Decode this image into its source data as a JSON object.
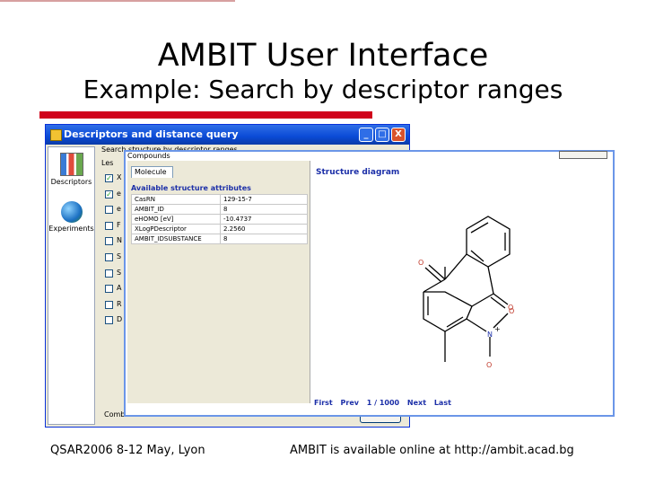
{
  "slide": {
    "title": "AMBIT  User Interface",
    "subtitle": "Example: Search by descriptor ranges",
    "footer_left": "QSAR2006 8-12 May, Lyon",
    "footer_right": "AMBIT is available online at http://ambit.acad.bg",
    "accent_color": "#d0021b"
  },
  "back_window": {
    "title": "Descriptors and distance query",
    "header_text": "Search structure by descriptor ranges",
    "column_label": "Les",
    "nav": [
      {
        "label": "Descriptors",
        "icon": "bar-chart-icon"
      },
      {
        "label": "Experiments",
        "icon": "globe-icon"
      }
    ],
    "rows": [
      {
        "checked": true,
        "label": "X"
      },
      {
        "checked": true,
        "label": "e"
      },
      {
        "checked": false,
        "label": "e"
      },
      {
        "checked": false,
        "label": "F"
      },
      {
        "checked": false,
        "label": "N"
      },
      {
        "checked": false,
        "label": "S"
      },
      {
        "checked": false,
        "label": "S"
      },
      {
        "checked": false,
        "label": "A"
      },
      {
        "checked": false,
        "label": "R"
      },
      {
        "checked": false,
        "label": "D"
      }
    ],
    "bottom_text": "Comb",
    "controls": {
      "minimize": "_",
      "maximize": "□",
      "close": "X"
    }
  },
  "front_window": {
    "tab_header": "Compounds",
    "molecule_tab": "Molecule",
    "attributes_title": "Available structure attributes",
    "attributes": [
      {
        "key": "CasRN",
        "value": "129-15-7"
      },
      {
        "key": "AMBIT_ID",
        "value": "8"
      },
      {
        "key": "eHOMO [eV]",
        "value": "-10.4737"
      },
      {
        "key": "XLogPDescriptor",
        "value": "2.2560"
      },
      {
        "key": "AMBIT_IDSUBSTANCE",
        "value": "8"
      }
    ],
    "structure_title": "Structure diagram",
    "atoms": {
      "o1": "O",
      "o2": "O",
      "n": "N",
      "plus": "+",
      "o3": "O",
      "o4": "O"
    },
    "pager": {
      "first": "First",
      "prev": "Prev",
      "position": "1 / 1000",
      "next": "Next",
      "last": "Last"
    }
  }
}
